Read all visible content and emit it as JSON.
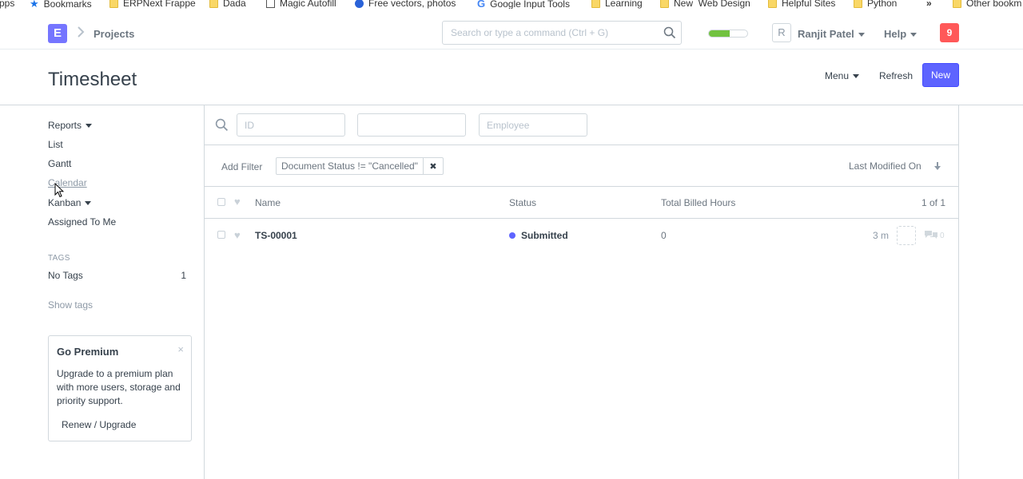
{
  "bookmarks_bar": {
    "items": [
      {
        "label": "pps",
        "icon": "none"
      },
      {
        "label": "Bookmarks",
        "icon": "star-icon"
      },
      {
        "label": "ERPNext Frappe",
        "icon": "folder-icon"
      },
      {
        "label": "Dada",
        "icon": "folder-icon"
      },
      {
        "label": "Magic Autofill",
        "icon": "page-icon"
      },
      {
        "label": "Free vectors, photos",
        "icon": "freepik-icon"
      },
      {
        "label": "Google Input Tools",
        "icon": "google-icon"
      },
      {
        "label": "Learning",
        "icon": "folder-icon"
      },
      {
        "label": "New  Web Design",
        "icon": "folder-icon"
      },
      {
        "label": "Helpful Sites",
        "icon": "folder-icon"
      },
      {
        "label": "Python",
        "icon": "folder-icon"
      },
      {
        "label": "»",
        "icon": "none"
      },
      {
        "label": "Other bookm",
        "icon": "folder-icon"
      }
    ]
  },
  "navbar": {
    "logo_letter": "E",
    "breadcrumb": "Projects",
    "search_placeholder": "Search or type a command (Ctrl + G)",
    "setup_progress": 0.55,
    "avatar_letter": "R",
    "user_name": "Ranjit Patel",
    "help_label": "Help",
    "notification_count": "9"
  },
  "page": {
    "title": "Timesheet",
    "menu_label": "Menu",
    "refresh_label": "Refresh",
    "new_label": "New"
  },
  "sidebar": {
    "items": [
      {
        "label": "Reports",
        "dropdown": true
      },
      {
        "label": "List",
        "dropdown": false
      },
      {
        "label": "Gantt",
        "dropdown": false
      },
      {
        "label": "Calendar",
        "dropdown": false
      },
      {
        "label": "Kanban",
        "dropdown": true
      },
      {
        "label": "Assigned To Me",
        "dropdown": false
      }
    ],
    "tags_heading": "TAGS",
    "no_tags_label": "No Tags",
    "no_tags_count": "1",
    "show_tags": "Show tags",
    "premium": {
      "title": "Go Premium",
      "text": "Upgrade to a premium plan with more users, storage and priority support.",
      "button": "Renew / Upgrade"
    }
  },
  "list": {
    "filters": {
      "id_placeholder": "ID",
      "blank_placeholder": "",
      "employee_placeholder": "Employee"
    },
    "add_filter": "Add Filter",
    "active_filter": "Document Status != \"Cancelled\"",
    "sort_label": "Last Modified On",
    "columns": {
      "name": "Name",
      "status": "Status",
      "hours": "Total Billed Hours",
      "count": "1 of 1"
    },
    "rows": [
      {
        "name": "TS-00001",
        "status": "Submitted",
        "status_color": "#5e64ff",
        "hours": "0",
        "modified": "3 m",
        "comments": "0"
      }
    ]
  },
  "colors": {
    "primary": "#5e64ff",
    "logo": "#7575ff",
    "notification": "#ff5858",
    "progress": "#71c240"
  }
}
